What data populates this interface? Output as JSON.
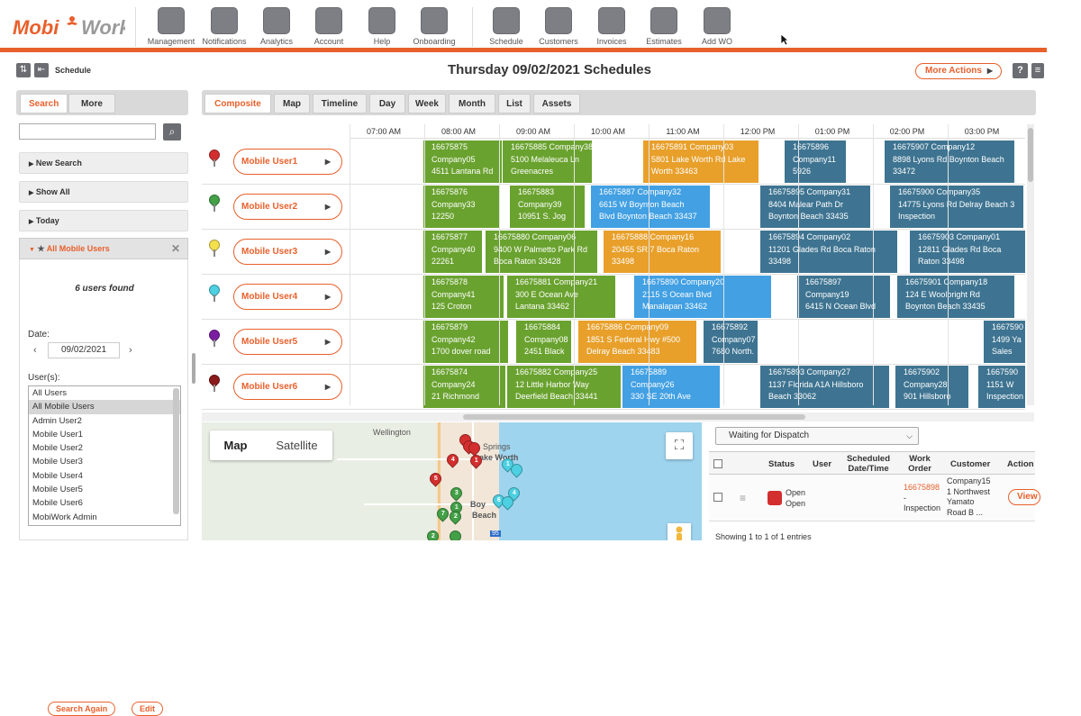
{
  "brand": {
    "logo_text_a": "Mobi",
    "logo_text_b": "Work",
    "accent": "#e8602c"
  },
  "toolbar": [
    {
      "label": "Management",
      "icon": "wrench-icon"
    },
    {
      "label": "Notifications",
      "icon": "exclamation-icon"
    },
    {
      "label": "Analytics",
      "icon": "bar-chart-icon"
    },
    {
      "label": "Account",
      "icon": "gears-icon"
    },
    {
      "label": "Help",
      "icon": "question-icon"
    },
    {
      "label": "Onboarding",
      "icon": "graduation-cap-icon"
    },
    {
      "label": "Schedule",
      "icon": "calendar-icon"
    },
    {
      "label": "Customers",
      "icon": "customer-icon"
    },
    {
      "label": "Invoices",
      "icon": "invoice-icon"
    },
    {
      "label": "Estimates",
      "icon": "calculator-icon"
    },
    {
      "label": "Add WO",
      "icon": "add-clipboard-icon"
    }
  ],
  "header": {
    "section_label": "Schedule",
    "title": "Thursday 09/02/2021 Schedules",
    "more_actions": "More Actions",
    "help": "?"
  },
  "sidebar": {
    "tabs": [
      "Search",
      "More"
    ],
    "items": [
      "New Search",
      "Show All",
      "Today"
    ],
    "active_filter": "All Mobile Users",
    "users_found": "6 users found",
    "date_label": "Date:",
    "date_value": "09/02/2021",
    "users_label": "User(s):",
    "user_options": [
      "All Users",
      "All Mobile Users",
      "Admin User2",
      "Mobile User1",
      "Mobile User2",
      "Mobile User3",
      "Mobile User4",
      "Mobile User5",
      "Mobile User6",
      "MobiWork Admin"
    ],
    "selected_user": "All Mobile Users",
    "search_again": "Search Again",
    "edit": "Edit"
  },
  "main_tabs": [
    "Composite",
    "Map",
    "Timeline",
    "Day",
    "Week",
    "Month",
    "List",
    "Assets"
  ],
  "times": [
    "07:00 AM",
    "08:00 AM",
    "09:00 AM",
    "10:00 AM",
    "11:00 AM",
    "12:00 PM",
    "01:00 PM",
    "02:00 PM",
    "03:00 PM"
  ],
  "users": [
    {
      "name": "Mobile User1",
      "pin": "#d32f2f"
    },
    {
      "name": "Mobile User2",
      "pin": "#43a047"
    },
    {
      "name": "Mobile User3",
      "pin": "#f4e04d"
    },
    {
      "name": "Mobile User4",
      "pin": "#4dd0e1"
    },
    {
      "name": "Mobile User5",
      "pin": "#7b1fa2"
    },
    {
      "name": "Mobile User6",
      "pin": "#8b1a1a"
    }
  ],
  "events": [
    [
      {
        "c": "g",
        "l": [
          "16675875",
          "Company05",
          "4511 Lantana Rd"
        ]
      },
      {
        "c": "g",
        "l": [
          "16675885 Company38",
          "5100 Melaleuca Ln",
          "Greenacres"
        ]
      },
      {
        "c": "o",
        "l": [
          "16675891 Company03",
          "5801 Lake Worth Rd Lake",
          "Worth 33463"
        ]
      },
      {
        "c": "t",
        "l": [
          "16675896",
          "Company11",
          "5926"
        ]
      },
      {
        "c": "t",
        "l": [
          "16675907 Company12",
          "8898 Lyons Rd Boynton Beach",
          "33472"
        ]
      }
    ],
    [
      {
        "c": "g",
        "l": [
          "16675876",
          "Company33",
          "12250"
        ]
      },
      {
        "c": "g",
        "l": [
          "16675883",
          "Company39",
          "10951 S. Jog"
        ]
      },
      {
        "c": "b",
        "l": [
          "16675887 Company32",
          "6615 W Boynton Beach",
          "Blvd Boynton Beach 33437"
        ]
      },
      {
        "c": "t",
        "l": [
          "16675895 Company31",
          "8404 Malear Path Dr",
          "Boynton Beach 33435"
        ]
      },
      {
        "c": "t",
        "l": [
          "16675900 Company35",
          "14775 Lyons Rd Delray Beach 3",
          "Inspection"
        ]
      }
    ],
    [
      {
        "c": "g",
        "l": [
          "16675877",
          "Company40",
          "22261"
        ]
      },
      {
        "c": "g",
        "l": [
          "16675880 Company06",
          "9400 W Palmetto Park Rd",
          "Boca Raton 33428"
        ]
      },
      {
        "c": "o",
        "l": [
          "16675888 Company16",
          "20455 SR 7 Boca Raton",
          "33498"
        ]
      },
      {
        "c": "t",
        "l": [
          "16675894 Company02",
          "11201 Glades Rd Boca Raton",
          "33498"
        ]
      },
      {
        "c": "t",
        "l": [
          "16675903 Company01",
          "12811 Glades Rd Boca",
          "Raton 33498"
        ]
      }
    ],
    [
      {
        "c": "g",
        "l": [
          "16675878",
          "Company41",
          "125 Croton"
        ]
      },
      {
        "c": "g",
        "l": [
          "16675881 Company21",
          "300 E Ocean Ave",
          "Lantana 33462"
        ]
      },
      {
        "c": "b",
        "l": [
          "16675890 Company20",
          "2115 S Ocean Blvd",
          "Manalapan 33462"
        ]
      },
      {
        "c": "t",
        "l": [
          "16675897",
          "Company19",
          "6415 N Ocean Blvd"
        ]
      },
      {
        "c": "t",
        "l": [
          "16675901 Company18",
          "124 E Woolbright Rd",
          "Boynton Beach 33435"
        ]
      }
    ],
    [
      {
        "c": "g",
        "l": [
          "16675879",
          "Company42",
          "1700 dover road"
        ]
      },
      {
        "c": "g",
        "l": [
          "16675884",
          "Company08",
          "2451 Black"
        ]
      },
      {
        "c": "o",
        "l": [
          "16675886 Company09",
          "1851 S Federal Hwy #500",
          "Delray Beach 33483"
        ]
      },
      {
        "c": "t",
        "l": [
          "16675892",
          "Company07",
          "7680 North."
        ]
      },
      {
        "c": "t",
        "l": [
          "1667590",
          "1499 Ya",
          "Sales"
        ]
      }
    ],
    [
      {
        "c": "g",
        "l": [
          "16675874",
          "Company24",
          "21 Richmond"
        ]
      },
      {
        "c": "g",
        "l": [
          "16675882 Company25",
          "12 Little Harbor Way",
          "Deerfield Beach 33441"
        ]
      },
      {
        "c": "b",
        "l": [
          "16675889",
          "Company26",
          "330 SE 20th Ave"
        ]
      },
      {
        "c": "t",
        "l": [
          "16675893 Company27",
          "1137 Florida A1A Hillsboro",
          "Beach 33062"
        ]
      },
      {
        "c": "t",
        "l": [
          "16675902",
          "Company28",
          "901 Hillsboro"
        ]
      },
      {
        "c": "t",
        "l": [
          "1667590",
          "1151 W",
          "Inspection"
        ]
      }
    ]
  ],
  "map": {
    "tab_map": "Map",
    "tab_satellite": "Satellite",
    "labels": [
      "Wellington",
      "Springs",
      "ake Worth",
      "Boy",
      "Beach",
      "95"
    ]
  },
  "dispatch": {
    "filter": "Waiting for Dispatch",
    "columns": [
      "Status",
      "User",
      "Scheduled Date/Time",
      "Work Order",
      "Customer",
      "Action"
    ],
    "row": {
      "status1": "Open",
      "status2": "Open",
      "wo_number": "16675898",
      "wo_dash": "-",
      "wo_type": "Inspection",
      "customer": [
        "Company15",
        "1 Northwest",
        "Yamato",
        "Road  B ..."
      ],
      "action": "View"
    },
    "footer": "Showing 1 to 1 of 1 entries"
  }
}
